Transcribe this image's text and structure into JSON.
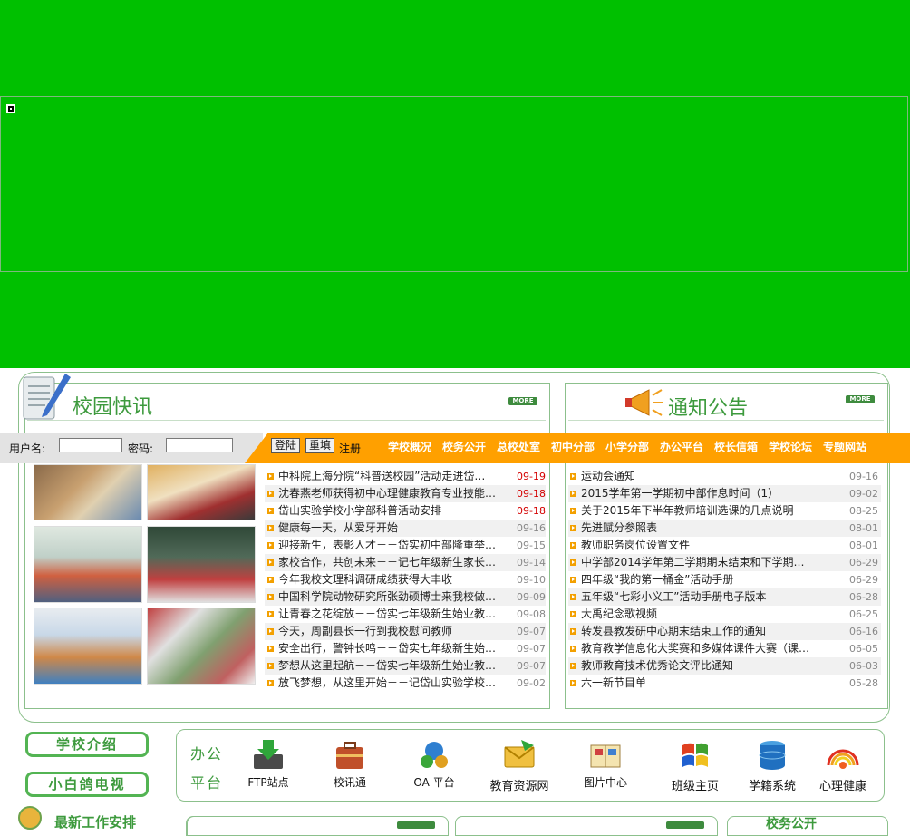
{
  "login": {
    "username_label": "用户名:",
    "password_label": "密码:",
    "login_button": "登陆",
    "reset_button": "重填",
    "register_link": "注册"
  },
  "nav": [
    "学校概况",
    "校务公开",
    "总校处室",
    "初中分部",
    "小学分部",
    "办公平台",
    "校长信箱",
    "学校论坛",
    "专题网站"
  ],
  "news": {
    "title": "校园快讯",
    "more": "MORE",
    "items": [
      {
        "title": "中科院上海分院“科普送校园”活动走进岱…",
        "date": "09-19",
        "highlight": true
      },
      {
        "title": "沈春燕老师获得初中心理健康教育专业技能…",
        "date": "09-18",
        "highlight": true
      },
      {
        "title": "岱山实验学校小学部科普活动安排",
        "date": "09-18",
        "highlight": true
      },
      {
        "title": "健康每一天，从爱牙开始",
        "date": "09-16",
        "highlight": false
      },
      {
        "title": "迎接新生，表彰人才－－岱实初中部隆重举…",
        "date": "09-15",
        "highlight": false
      },
      {
        "title": "家校合作，共创未来－－记七年级新生家长…",
        "date": "09-14",
        "highlight": false
      },
      {
        "title": "今年我校文理科调研成绩获得大丰收",
        "date": "09-10",
        "highlight": false
      },
      {
        "title": "中国科学院动物研究所张劲硕博士来我校做…",
        "date": "09-09",
        "highlight": false
      },
      {
        "title": "让青春之花绽放－－岱实七年级新生始业教…",
        "date": "09-08",
        "highlight": false
      },
      {
        "title": "今天，周副县长一行到我校慰问教师",
        "date": "09-07",
        "highlight": false
      },
      {
        "title": "安全出行，警钟长鸣－－岱实七年级新生始…",
        "date": "09-07",
        "highlight": false
      },
      {
        "title": "梦想从这里起航－－岱实七年级新生始业教…",
        "date": "09-07",
        "highlight": false
      },
      {
        "title": "放飞梦想，从这里开始－－记岱山实验学校…",
        "date": "09-02",
        "highlight": false
      }
    ]
  },
  "notices": {
    "title": "通知公告",
    "more": "MORE",
    "items": [
      {
        "title": "运动会通知",
        "date": "09-16"
      },
      {
        "title": "2015学年第一学期初中部作息时间（1）",
        "date": "09-02"
      },
      {
        "title": "关于2015年下半年教师培训选课的几点说明",
        "date": "08-25"
      },
      {
        "title": "先进赋分参照表",
        "date": "08-01"
      },
      {
        "title": "教师职务岗位设置文件",
        "date": "08-01"
      },
      {
        "title": "中学部2014学年第二学期期末结束和下学期开…",
        "date": "06-29"
      },
      {
        "title": "四年级“我的第一桶金”活动手册",
        "date": "06-29"
      },
      {
        "title": "五年级“七彩小义工”活动手册电子版本",
        "date": "06-28"
      },
      {
        "title": "大禹纪念歌视频",
        "date": "06-25"
      },
      {
        "title": "转发县教发研中心期末结束工作的通知",
        "date": "06-16"
      },
      {
        "title": "教育教学信息化大奖赛和多媒体课件大赛（课…",
        "date": "06-05"
      },
      {
        "title": "教师教育技术优秀论文评比通知",
        "date": "06-03"
      },
      {
        "title": "六一新节目单",
        "date": "05-28"
      }
    ]
  },
  "side_buttons": [
    "学校介绍",
    "小白鸽电视"
  ],
  "platform": {
    "label_top": "办公",
    "label_bottom": "平台",
    "items": [
      "FTP站点",
      "校讯通",
      "OA 平台",
      "教育资源网",
      "图片中心",
      "班级主页",
      "学籍系统",
      "心理健康"
    ]
  },
  "bottom": {
    "title": "最新工作安排",
    "school_public": "校务公开"
  },
  "colors": {
    "banner_green": "#00c000",
    "accent_orange": "#ffa000",
    "title_green": "#3d9a3d",
    "date_red": "#d40000"
  }
}
